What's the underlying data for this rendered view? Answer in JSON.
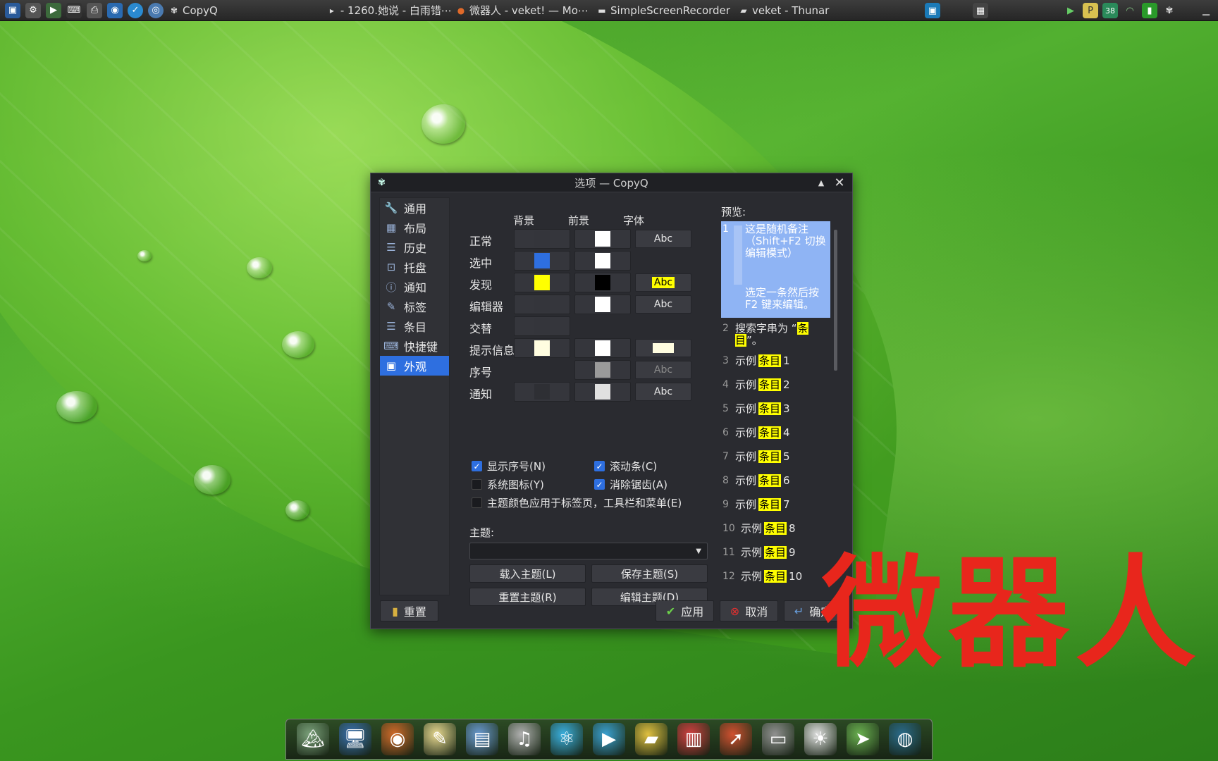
{
  "taskbar": {
    "tasks": [
      {
        "label": "CopyQ",
        "icon": "clover-icon"
      },
      {
        "label": "- 1260.她说 - 白雨错⋯",
        "icon": "play-icon"
      },
      {
        "label": "微器人 - veket! — Mo⋯",
        "icon": "firefox-icon"
      },
      {
        "label": "SimpleScreenRecorder",
        "icon": "window-icon"
      },
      {
        "label": "veket - Thunar",
        "icon": "folder-icon"
      }
    ],
    "tray": {
      "temperature": "38"
    }
  },
  "dialog": {
    "title": "选项 — CopyQ",
    "sidebar": [
      {
        "label": "通用",
        "icon": "wrench-icon",
        "glyph": "🔧"
      },
      {
        "label": "布局",
        "icon": "layout-icon",
        "glyph": "▦"
      },
      {
        "label": "历史",
        "icon": "list-icon",
        "glyph": "☰"
      },
      {
        "label": "托盘",
        "icon": "tray-icon",
        "glyph": "⊡"
      },
      {
        "label": "通知",
        "icon": "info-icon",
        "glyph": "ⓘ"
      },
      {
        "label": "标签",
        "icon": "tag-icon",
        "glyph": "✎"
      },
      {
        "label": "条目",
        "icon": "items-icon",
        "glyph": "☰"
      },
      {
        "label": "快捷键",
        "icon": "keyboard-icon",
        "glyph": "⌨"
      },
      {
        "label": "外观",
        "icon": "image-icon",
        "glyph": "▣"
      }
    ],
    "columns": {
      "background": "背景",
      "foreground": "前景",
      "font": "字体"
    },
    "rows": [
      {
        "label": "正常",
        "bg": "#34353b",
        "fg": "#ffffff",
        "font": "Abc",
        "font_style": "plain"
      },
      {
        "label": "选中",
        "bg": "#2e6fe0",
        "fg": "#ffffff",
        "font": null
      },
      {
        "label": "发现",
        "bg": "#ffff00",
        "fg": "#000000",
        "font": "Abc",
        "font_style": "highlight"
      },
      {
        "label": "编辑器",
        "bg": "#34353b",
        "fg": "#ffffff",
        "font": "Abc",
        "font_style": "plain"
      },
      {
        "label": "交替",
        "bg": "#34353b",
        "fg": null,
        "font": null
      },
      {
        "label": "提示信息",
        "bg": "#fffde0",
        "fg": "#ffffff",
        "font": "",
        "font_style": "tooltip"
      },
      {
        "label": "序号",
        "bg": null,
        "fg": "#9a9a9a",
        "font": "Abc",
        "font_style": "dim"
      },
      {
        "label": "通知",
        "bg": "#2e2f34",
        "fg": "#e0e0e0",
        "font": "Abc",
        "font_style": "plain"
      }
    ],
    "checkboxes": [
      {
        "label": "显示序号(N)",
        "checked": true
      },
      {
        "label": "滚动条(C)",
        "checked": true
      },
      {
        "label": "系统图标(Y)",
        "checked": false
      },
      {
        "label": "消除锯齿(A)",
        "checked": true
      },
      {
        "label": "主题颜色应用于标签页，工具栏和菜单(E)",
        "checked": false
      }
    ],
    "theme": {
      "label": "主题:",
      "value": "",
      "load": "载入主题(L)",
      "save": "保存主题(S)",
      "reset": "重置主题(R)",
      "edit": "编辑主题(D)"
    },
    "preview": {
      "label": "预览:",
      "selected": {
        "num": "1",
        "line1": "这是随机备注（Shift+F2 切换编辑模式）",
        "line2": "选定一条然后按 F2 键来编辑。"
      },
      "search": {
        "num": "2",
        "prefix": "搜索字串为 “",
        "word": "条目",
        "suffix": "”。"
      },
      "items": [
        {
          "num": "3",
          "a": "示例",
          "b": "条目",
          "c": "1"
        },
        {
          "num": "4",
          "a": "示例",
          "b": "条目",
          "c": "2"
        },
        {
          "num": "5",
          "a": "示例",
          "b": "条目",
          "c": "3"
        },
        {
          "num": "6",
          "a": "示例",
          "b": "条目",
          "c": "4"
        },
        {
          "num": "7",
          "a": "示例",
          "b": "条目",
          "c": "5"
        },
        {
          "num": "8",
          "a": "示例",
          "b": "条目",
          "c": "6"
        },
        {
          "num": "9",
          "a": "示例",
          "b": "条目",
          "c": "7"
        },
        {
          "num": "10",
          "a": "示例",
          "b": "条目",
          "c": "8"
        },
        {
          "num": "11",
          "a": "示例",
          "b": "条目",
          "c": "9"
        },
        {
          "num": "12",
          "a": "示例",
          "b": "条目",
          "c": "10"
        }
      ]
    },
    "buttons": {
      "reset": "重置",
      "apply": "应用",
      "cancel": "取消",
      "ok": "确定"
    }
  },
  "watermark": "微器人",
  "dock": [
    "desktop-icon",
    "computer-icon",
    "firefox-icon",
    "text-editor-icon",
    "image-viewer-icon",
    "music-icon",
    "atom-icon",
    "media-player-icon",
    "notes-icon",
    "chart-icon",
    "rocket-icon",
    "drive-icon",
    "brightness-icon",
    "next-icon",
    "globe-icon"
  ]
}
